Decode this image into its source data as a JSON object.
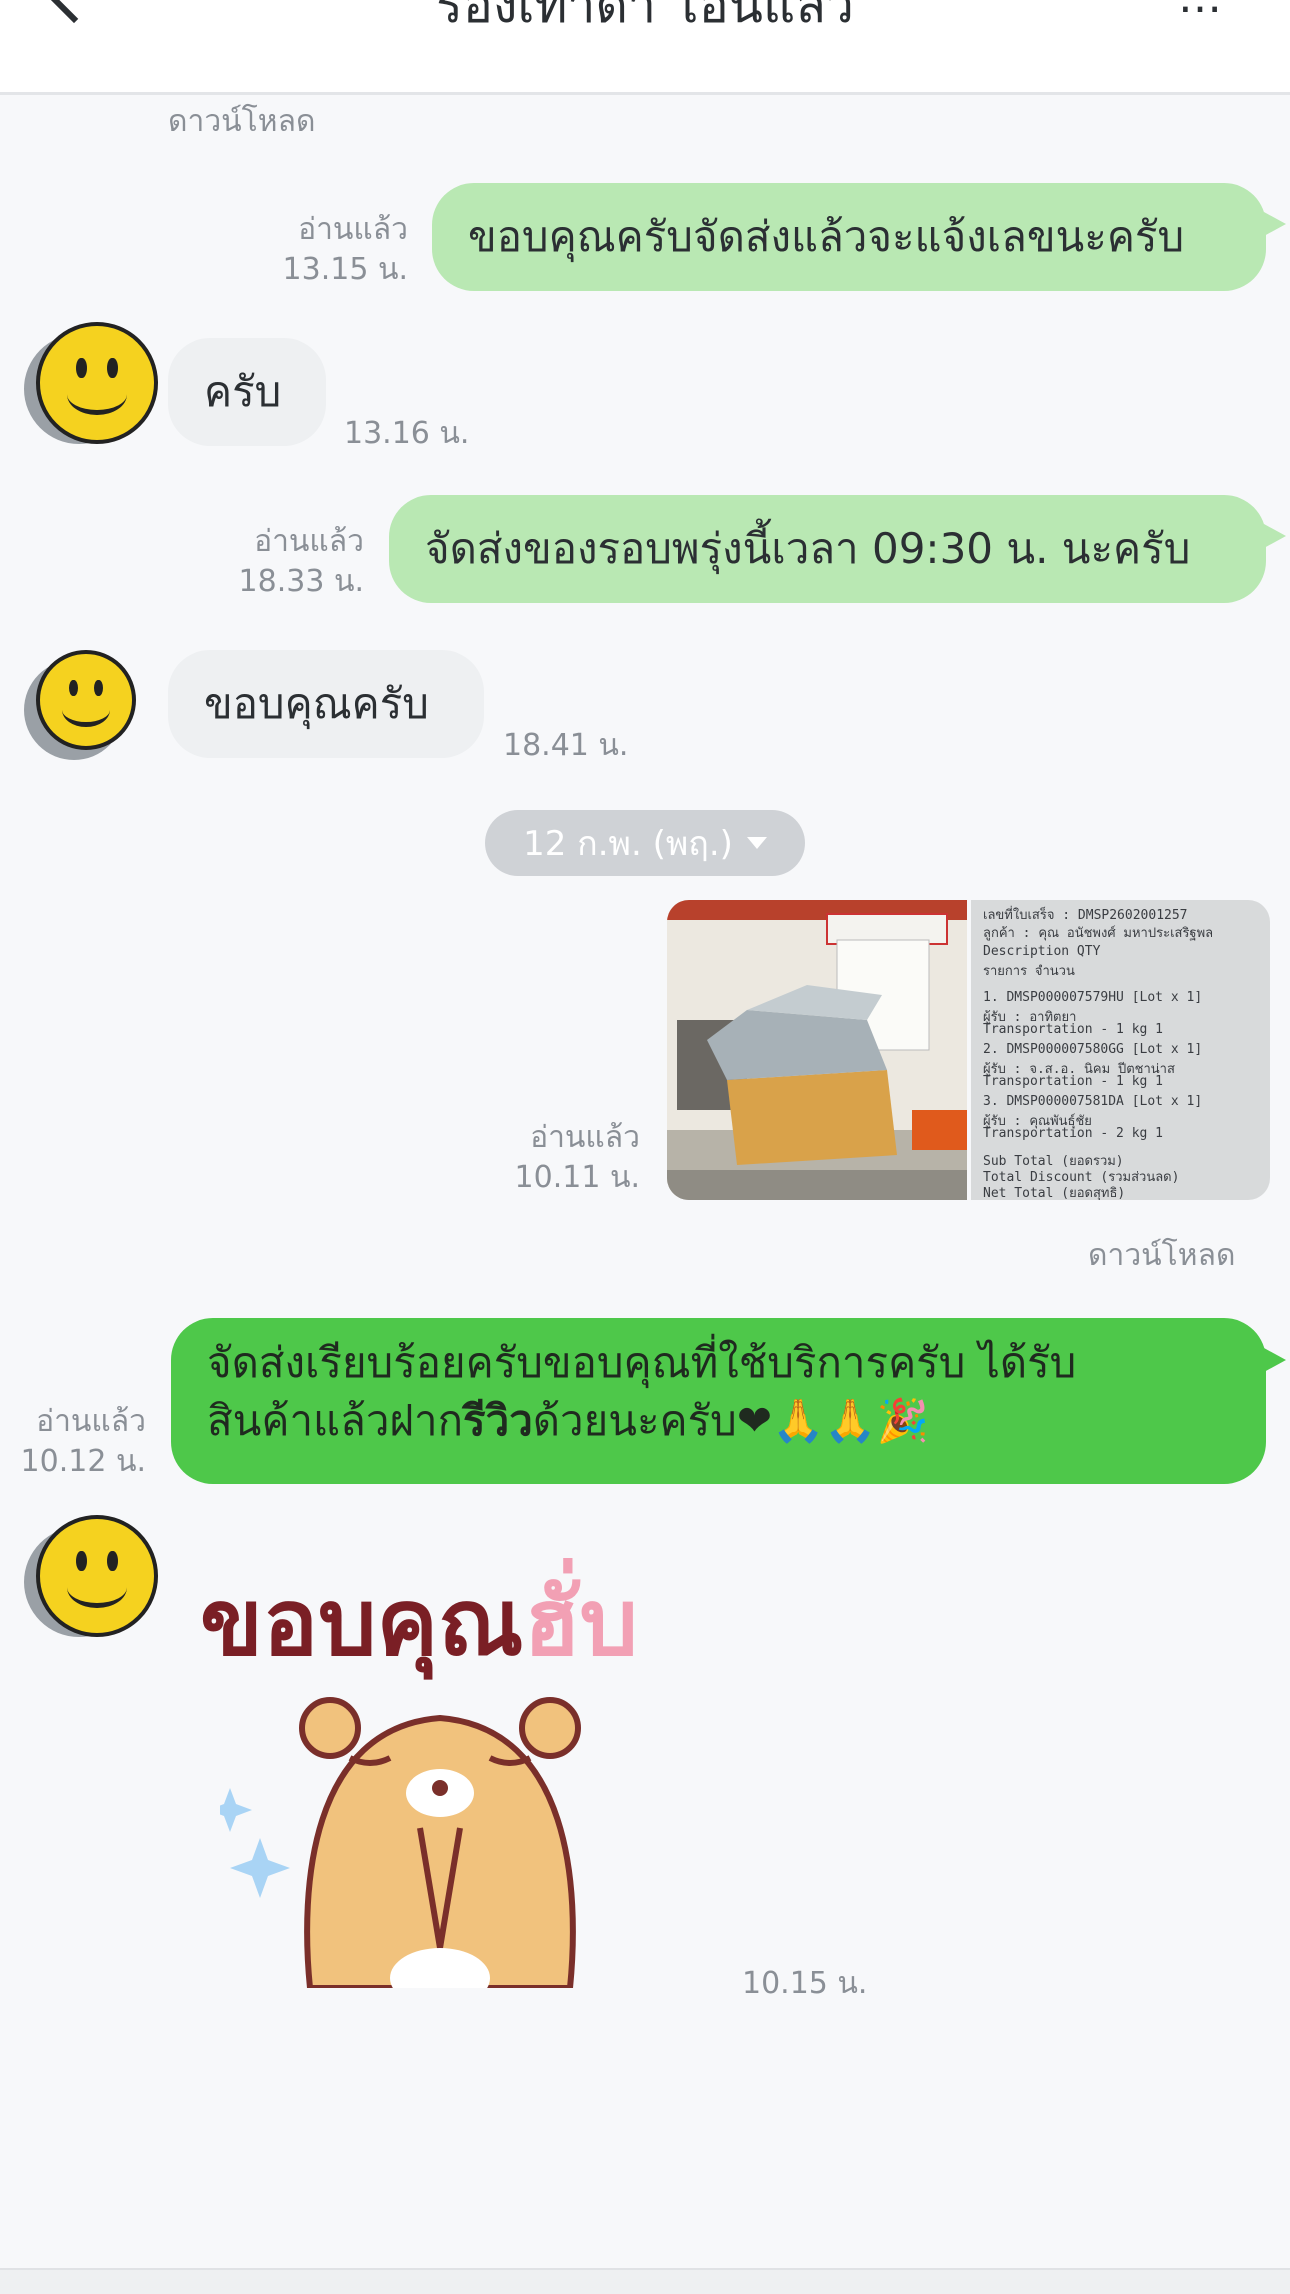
{
  "header": {
    "title": "ร้องเท้าดำ โอนแล้ว"
  },
  "messages": {
    "download_top": "ดาวน์โหลด",
    "m1": {
      "text": "ขอบคุณครับจัดส่งแล้วจะแจ้งเลขนะครับ",
      "read": "อ่านแล้ว",
      "time": "13.15 น."
    },
    "m2": {
      "text": "ครับ",
      "time": "13.16 น."
    },
    "m3": {
      "text": "จัดส่งของรอบพรุ่งนี้เวลา 09:30 น. นะครับ",
      "read": "อ่านแล้ว",
      "time": "18.33 น."
    },
    "m4": {
      "text": "ขอบคุณครับ",
      "time": "18.41 น."
    },
    "date_chip": "12 ก.พ. (พฤ.)",
    "m5": {
      "read": "อ่านแล้ว",
      "time": "10.11 น.",
      "download": "ดาวน์โหลด"
    },
    "m6": {
      "line1": "จัดส่งเรียบร้อยครับขอบคุณที่ใช้บริการครับ ได้รับ",
      "line2_a": "สินค้าแล้วฝาก",
      "line2_bold": "รีวิว",
      "line2_b": "ด้วยนะครับ",
      "emojis": "❤🙏🙏🎉",
      "read": "อ่านแล้ว",
      "time": "10.12 น."
    },
    "m7": {
      "sticker_text_a": "ขอบคุณ",
      "sticker_text_b": "ฮั่บ",
      "time": "10.15 น."
    }
  },
  "receipt": {
    "lines": [
      "เลขที่ใบเสร็จ : DMSP2602001257",
      "ลูกค้า : คุณ อนัชพงศ์ มหาประเสริฐพล",
      "Description                QTY",
      "รายการ                   จำนวน",
      "1. DMSP000007579HU [Lot x 1]",
      "   ผู้รับ : อาทิตยา",
      "   Transportation - 1 kg      1",
      "2. DMSP000007580GG [Lot x 1]",
      "   ผู้รับ : จ.ส.อ. นิคม ปีตชาน่าส",
      "   Transportation - 1 kg      1",
      "3. DMSP000007581DA [Lot x 1]",
      "   ผู้รับ : คุณพันธุ์ชัย",
      "   Transportation - 2 kg      1",
      "Sub Total (ยอดรวม)",
      "Total Discount (รวมส่วนลด)",
      "Net Total (ยอดสุทธิ)"
    ]
  },
  "colors": {
    "outgoing_bubble": "#b9e8b3",
    "outgoing_strong": "#4ec84a",
    "incoming_bubble": "#eef0f2",
    "meta_text": "#8a8f96"
  }
}
